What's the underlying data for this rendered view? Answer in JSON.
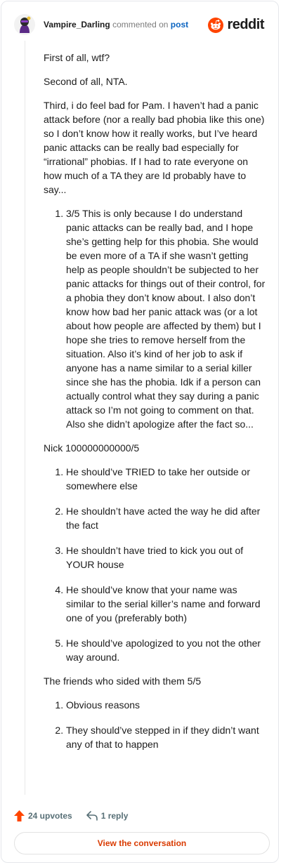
{
  "header": {
    "username": "Vampire_Darling",
    "action_text": "commented on",
    "post_link": "post",
    "brand": "reddit"
  },
  "comment": {
    "intro": [
      "First of all, wtf?",
      "Second of all, NTA."
    ],
    "pam_intro": "Third, i do feel bad for Pam. I haven’t had a panic attack before (nor a really bad phobia like this one) so I don’t know how it really works, but I’ve heard panic attacks can be really bad especially for “irrational” phobias. If I had to rate everyone on how much of a TA they are Id probably have to say...",
    "pam_list": [
      "3/5 This is only because I do understand panic attacks can be really bad, and I hope she’s getting help for this phobia. She would be even more of a TA if she wasn’t getting help as people shouldn’t be subjected to her panic attacks for things out of their control, for a phobia they don’t know about. I also don’t know how bad her panic attack was (or a lot about how people are affected by them) but I hope she tries to remove herself from the situation. Also it’s kind of her job to ask if anyone has a name similar to a serial killer since she has the phobia. Idk if a person can actually control what they say during a panic attack so I’m not going to comment on that. Also she didn’t apologize after the fact so..."
    ],
    "nick_heading": "Nick 100000000000/5",
    "nick_list": [
      "He should’ve TRIED to take her outside or somewhere else",
      "He shouldn’t have acted the way he did after the fact",
      "He shouldn’t have tried to kick you out of YOUR house",
      "He should’ve know that your name was similar to the serial killer’s name and forward one of you (preferably both)",
      "He should’ve apologized to you not the other way around."
    ],
    "friends_heading": "The friends who sided with them 5/5",
    "friends_list": [
      "Obvious reasons",
      "They should’ve stepped in if they didn’t want any of that to happen"
    ]
  },
  "footer": {
    "upvotes": "24 upvotes",
    "replies": "1 reply",
    "view_button": "View the conversation"
  },
  "colors": {
    "upvote": "#ff4500",
    "link": "#0b64c1",
    "button_text": "#d93a00"
  }
}
